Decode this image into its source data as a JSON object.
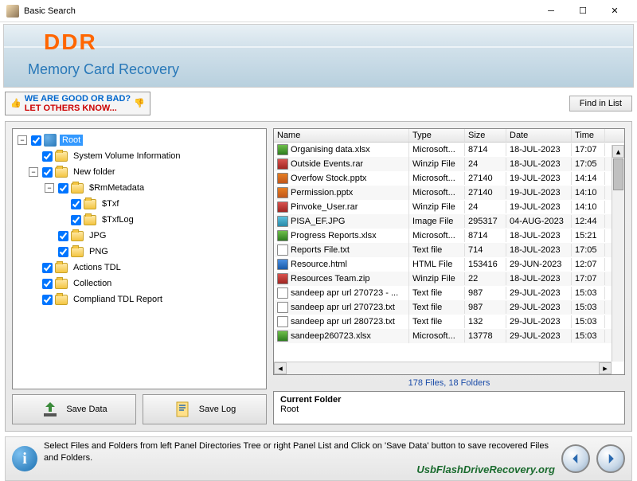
{
  "window": {
    "title": "Basic Search"
  },
  "header": {
    "logo": "DDR",
    "subtitle": "Memory Card Recovery"
  },
  "toolbar": {
    "feedback_line1": "WE ARE GOOD OR BAD?",
    "feedback_line2": "LET OTHERS KNOW...",
    "find_label": "Find in List"
  },
  "tree": {
    "root": "Root",
    "items": [
      "System Volume Information",
      "New folder",
      "$RmMetadata",
      "$Txf",
      "$TxfLog",
      "JPG",
      "PNG",
      "Actions TDL",
      "Collection",
      "Compliand TDL Report"
    ]
  },
  "buttons": {
    "save_data": "Save Data",
    "save_log": "Save Log"
  },
  "list": {
    "headers": {
      "name": "Name",
      "type": "Type",
      "size": "Size",
      "date": "Date",
      "time": "Time"
    },
    "rows": [
      {
        "icon": "x",
        "name": "Organising data.xlsx",
        "type": "Microsoft...",
        "size": "8714",
        "date": "18-JUL-2023",
        "time": "17:07"
      },
      {
        "icon": "z",
        "name": "Outside Events.rar",
        "type": "Winzip File",
        "size": "24",
        "date": "18-JUL-2023",
        "time": "17:05"
      },
      {
        "icon": "p",
        "name": "Overfow Stock.pptx",
        "type": "Microsoft...",
        "size": "27140",
        "date": "19-JUL-2023",
        "time": "14:14"
      },
      {
        "icon": "p",
        "name": "Permission.pptx",
        "type": "Microsoft...",
        "size": "27140",
        "date": "19-JUL-2023",
        "time": "14:10"
      },
      {
        "icon": "z",
        "name": "Pinvoke_User.rar",
        "type": "Winzip File",
        "size": "24",
        "date": "19-JUL-2023",
        "time": "14:10"
      },
      {
        "icon": "i",
        "name": "PISA_EF.JPG",
        "type": "Image File",
        "size": "295317",
        "date": "04-AUG-2023",
        "time": "12:44"
      },
      {
        "icon": "x",
        "name": "Progress Reports.xlsx",
        "type": "Microsoft...",
        "size": "8714",
        "date": "18-JUL-2023",
        "time": "15:21"
      },
      {
        "icon": "t",
        "name": "Reports File.txt",
        "type": "Text file",
        "size": "714",
        "date": "18-JUL-2023",
        "time": "17:05"
      },
      {
        "icon": "h",
        "name": "Resource.html",
        "type": "HTML File",
        "size": "153416",
        "date": "29-JUN-2023",
        "time": "12:07"
      },
      {
        "icon": "z",
        "name": "Resources Team.zip",
        "type": "Winzip File",
        "size": "22",
        "date": "18-JUL-2023",
        "time": "17:07"
      },
      {
        "icon": "t",
        "name": "sandeep apr url 270723 - ...",
        "type": "Text file",
        "size": "987",
        "date": "29-JUL-2023",
        "time": "15:03"
      },
      {
        "icon": "t",
        "name": "sandeep apr url 270723.txt",
        "type": "Text file",
        "size": "987",
        "date": "29-JUL-2023",
        "time": "15:03"
      },
      {
        "icon": "t",
        "name": "sandeep apr url 280723.txt",
        "type": "Text file",
        "size": "132",
        "date": "29-JUL-2023",
        "time": "15:03"
      },
      {
        "icon": "x",
        "name": "sandeep260723.xlsx",
        "type": "Microsoft...",
        "size": "13778",
        "date": "29-JUL-2023",
        "time": "15:03"
      }
    ],
    "summary": "178 Files, 18 Folders"
  },
  "current_folder": {
    "label": "Current Folder",
    "value": "Root"
  },
  "footer": {
    "hint": "Select Files and Folders from left Panel Directories Tree or right Panel List and Click on 'Save Data' button to save recovered Files and Folders.",
    "url": "UsbFlashDriveRecovery.org"
  }
}
